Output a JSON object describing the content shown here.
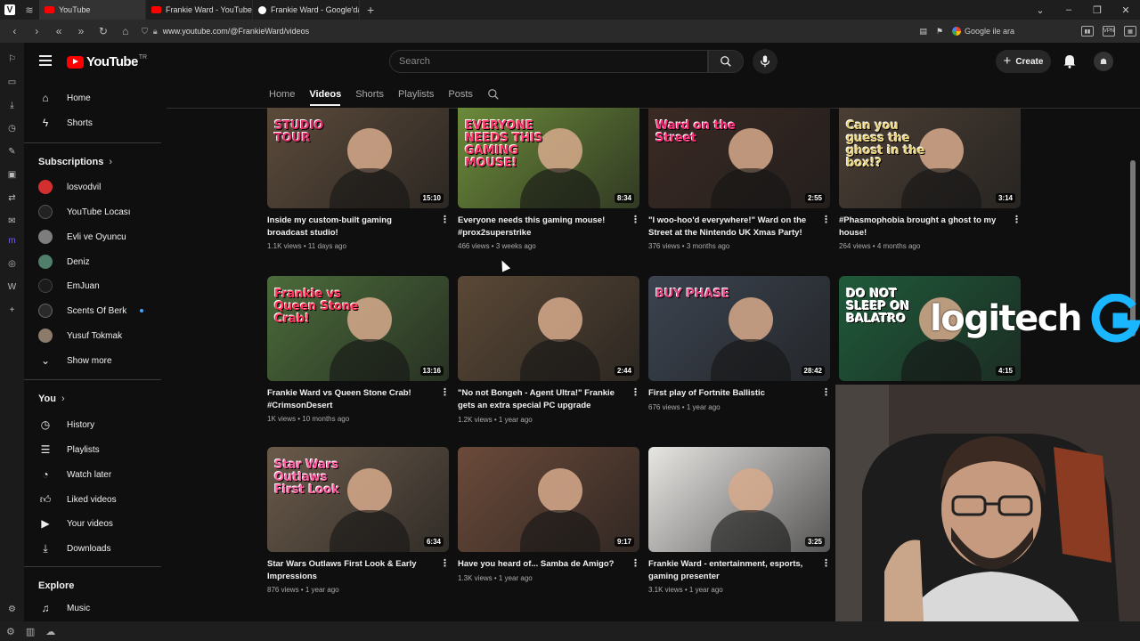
{
  "browser": {
    "tabs": [
      {
        "label": "YouTube",
        "active": true
      },
      {
        "label": "Frankie Ward - YouTube",
        "active": false
      },
      {
        "label": "Frankie Ward - Google'da A",
        "active": false
      }
    ],
    "url": "www.youtube.com/@FrankieWard/videos",
    "search_engine_label": "Google ile ara",
    "vpn_label": "VPN"
  },
  "youtube": {
    "logo_text": "YouTube",
    "region": "TR",
    "search_placeholder": "Search",
    "create_label": "Create"
  },
  "sidebar": {
    "main": [
      {
        "label": "Home",
        "icon": "home-icon"
      },
      {
        "label": "Shorts",
        "icon": "shorts-icon"
      }
    ],
    "subscriptions_heading": "Subscriptions",
    "subscriptions": [
      {
        "label": "losvodvil",
        "color": "#d32f2f"
      },
      {
        "label": "YouTube Locası",
        "color": "#222222"
      },
      {
        "label": "Evli ve Oyuncu",
        "color": "#7d7d7d"
      },
      {
        "label": "Deniz",
        "color": "#4f7f6a"
      },
      {
        "label": "EmJuan",
        "color": "#1b1b1b"
      },
      {
        "label": "Scents Of Berk",
        "color": "#2a2a2a",
        "live": true
      },
      {
        "label": "Yusuf Tokmak",
        "color": "#8c7b6b"
      }
    ],
    "show_more_label": "Show more",
    "you_heading": "You",
    "you_items": [
      {
        "label": "History",
        "icon": "history-icon"
      },
      {
        "label": "Playlists",
        "icon": "playlists-icon"
      },
      {
        "label": "Watch later",
        "icon": "watch-later-icon"
      },
      {
        "label": "Liked videos",
        "icon": "like-icon"
      },
      {
        "label": "Your videos",
        "icon": "your-videos-icon"
      },
      {
        "label": "Downloads",
        "icon": "download-icon"
      }
    ],
    "explore_heading": "Explore",
    "explore_items": [
      {
        "label": "Music",
        "icon": "music-icon"
      }
    ]
  },
  "channel_tabs": [
    "Home",
    "Videos",
    "Shorts",
    "Playlists",
    "Posts"
  ],
  "channel_tab_selected": "Videos",
  "videos": [
    {
      "title": "Inside my custom-built gaming broadcast studio!",
      "meta": "1.1K views • 11 days ago",
      "duration": "15:10",
      "thumb_text": "STUDIO TOUR",
      "bg": "#5b4a3a",
      "accent": "#e2306c"
    },
    {
      "title": "Everyone needs this gaming mouse! #prox2superstrike",
      "meta": "466 views • 3 weeks ago",
      "duration": "8:34",
      "thumb_text": "EVERYONE NEEDS THIS GAMING MOUSE!",
      "bg": "#6b8a3a",
      "accent": "#ff3b6b"
    },
    {
      "title": "\"I woo-hoo'd everywhere!\" Ward on the Street at the Nintendo UK Xmas Party!",
      "meta": "376 views • 3 months ago",
      "duration": "2:55",
      "thumb_text": "Ward on the Street",
      "bg": "#3a2a24",
      "accent": "#ff2d7a"
    },
    {
      "title": "#Phasmophobia brought a ghost to my house!",
      "meta": "264 views • 4 months ago",
      "duration": "3:14",
      "thumb_text": "Can you guess the ghost in the box!?",
      "bg": "#4a3e34",
      "accent": "#e9d27a"
    },
    {
      "title": "Frankie Ward vs Queen Stone Crab! #CrimsonDesert",
      "meta": "1K views • 10 months ago",
      "duration": "13:16",
      "thumb_text": "Frankie vs Queen Stone Crab!",
      "bg": "#4b6b3a",
      "accent": "#ff3355"
    },
    {
      "title": "\"No not Bongeh - Agent Ultra!\" Frankie gets an extra special PC upgrade #intelcoreultra",
      "meta": "1.2K views • 1 year ago",
      "duration": "2:44",
      "thumb_text": "",
      "bg": "#5a4836",
      "accent": "#c9a66b"
    },
    {
      "title": "First play of Fortnite Ballistic",
      "meta": "676 views • 1 year ago",
      "duration": "28:42",
      "thumb_text": "BUY PHASE",
      "bg": "#3c4450",
      "accent": "#e44b8a"
    },
    {
      "title": "",
      "meta": "",
      "duration": "4:15",
      "thumb_text": "DO NOT SLEEP ON BALATRO",
      "bg": "#1f5a3a",
      "accent": "#ffffff"
    },
    {
      "title": "Star Wars Outlaws First Look & Early Impressions",
      "meta": "876 views • 1 year ago",
      "duration": "6:34",
      "thumb_text": "Star Wars Outlaws First Look",
      "bg": "#6a5a4a",
      "accent": "#ff5fa2"
    },
    {
      "title": "Have you heard of... Samba de Amigo?",
      "meta": "1.3K views • 1 year ago",
      "duration": "9:17",
      "thumb_text": "",
      "bg": "#6b4a3a",
      "accent": "#f2b84b"
    },
    {
      "title": "Frankie Ward - entertainment, esports, gaming presenter",
      "meta": "3.1K views • 1 year ago",
      "duration": "3:25",
      "thumb_text": "",
      "bg": "#e8e6e3",
      "accent": "#b9b9b9"
    }
  ],
  "overlay": {
    "sponsor_text": "logitech"
  }
}
